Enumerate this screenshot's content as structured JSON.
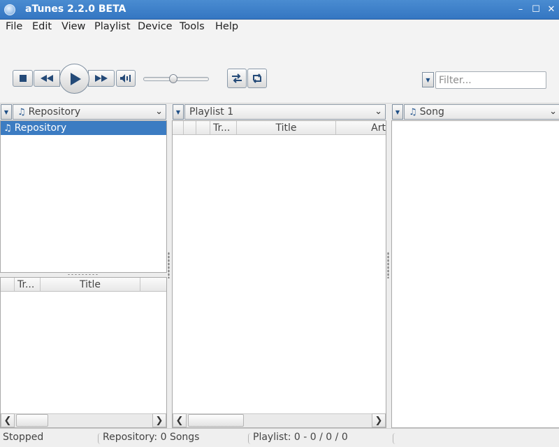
{
  "window": {
    "title": "aTunes 2.2.0 BETA",
    "minimize_glyph": "–",
    "maximize_glyph": "☐",
    "close_glyph": "✕"
  },
  "menu": [
    "File",
    "Edit",
    "View",
    "Playlist",
    "Device",
    "Tools",
    "Help"
  ],
  "player": {
    "stop_icon": "stop-icon",
    "previous_icon": "previous-icon",
    "play_icon": "play-icon",
    "next_icon": "next-icon",
    "mute_icon": "volume-icon",
    "shuffle_icon": "shuffle-icon",
    "repeat_icon": "repeat-icon",
    "volume_level": 0.45
  },
  "filter": {
    "placeholder": "Filter...",
    "value": ""
  },
  "navigator": {
    "selector": "Repository",
    "tree_items": [
      "Repository"
    ],
    "columns": [
      "Tr...",
      "Title"
    ]
  },
  "playlist": {
    "selector": "Playlist 1",
    "columns": [
      "Tr...",
      "Title",
      "Art"
    ]
  },
  "context": {
    "selector": "Song"
  },
  "status": {
    "state": "Stopped",
    "repository": "Repository: 0 Songs",
    "playlist": "Playlist: 0 - 0 / 0 / 0"
  },
  "colors": {
    "titlebar": "#3b7fc6",
    "selection": "#3c7cc2",
    "icon_blue": "#244a78"
  }
}
